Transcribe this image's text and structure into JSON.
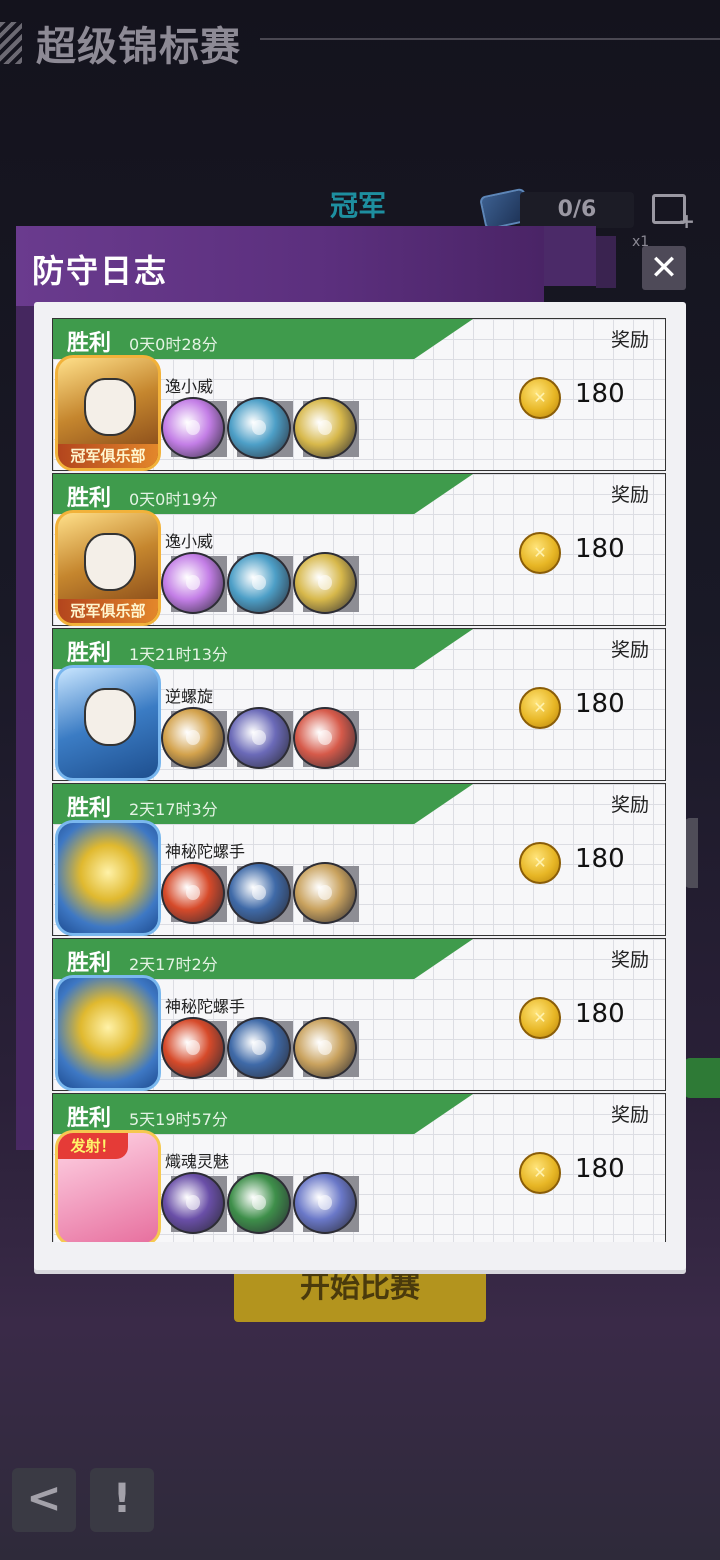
{
  "screen": {
    "title": "超级锦标赛",
    "tier": "冠军",
    "ticket_counter": "0/6",
    "ticket_multiplier": "x1",
    "start_button": "开始比赛",
    "back_icon": "back-arrow-icon",
    "info_icon": "exclamation-icon"
  },
  "modal": {
    "title": "防守日志",
    "close_icon": "close-icon"
  },
  "entries": [
    {
      "result": "胜利",
      "duration": "0天0时28分",
      "reward_label": "奖励",
      "player": "逸小威",
      "avatar_badge": "冠军俱乐部",
      "amount": "180",
      "beys": [
        "#c37ee6",
        "#4d9fc7",
        "#d7b84b"
      ]
    },
    {
      "result": "胜利",
      "duration": "0天0时19分",
      "reward_label": "奖励",
      "player": "逸小威",
      "avatar_badge": "冠军俱乐部",
      "amount": "180",
      "beys": [
        "#c37ee6",
        "#4d9fc7",
        "#d7b84b"
      ]
    },
    {
      "result": "胜利",
      "duration": "1天21时13分",
      "reward_label": "奖励",
      "player": "逆螺旋",
      "avatar_badge": "",
      "amount": "180",
      "beys": [
        "#d3a24c",
        "#6b6ab8",
        "#d65a4a"
      ]
    },
    {
      "result": "胜利",
      "duration": "2天17时3分",
      "reward_label": "奖励",
      "player": "神秘陀螺手",
      "avatar_badge": "",
      "amount": "180",
      "beys": [
        "#d64a2a",
        "#3f6aa8",
        "#c9a25e"
      ]
    },
    {
      "result": "胜利",
      "duration": "2天17时2分",
      "reward_label": "奖励",
      "player": "神秘陀螺手",
      "avatar_badge": "",
      "amount": "180",
      "beys": [
        "#d64a2a",
        "#3f6aa8",
        "#c9a25e"
      ]
    },
    {
      "result": "胜利",
      "duration": "5天19时57分",
      "reward_label": "奖励",
      "player": "熾魂灵魅",
      "avatar_badge": "发射！",
      "amount": "180",
      "beys": [
        "#6a4fa8",
        "#3e8f4a",
        "#6a78c8"
      ]
    }
  ]
}
